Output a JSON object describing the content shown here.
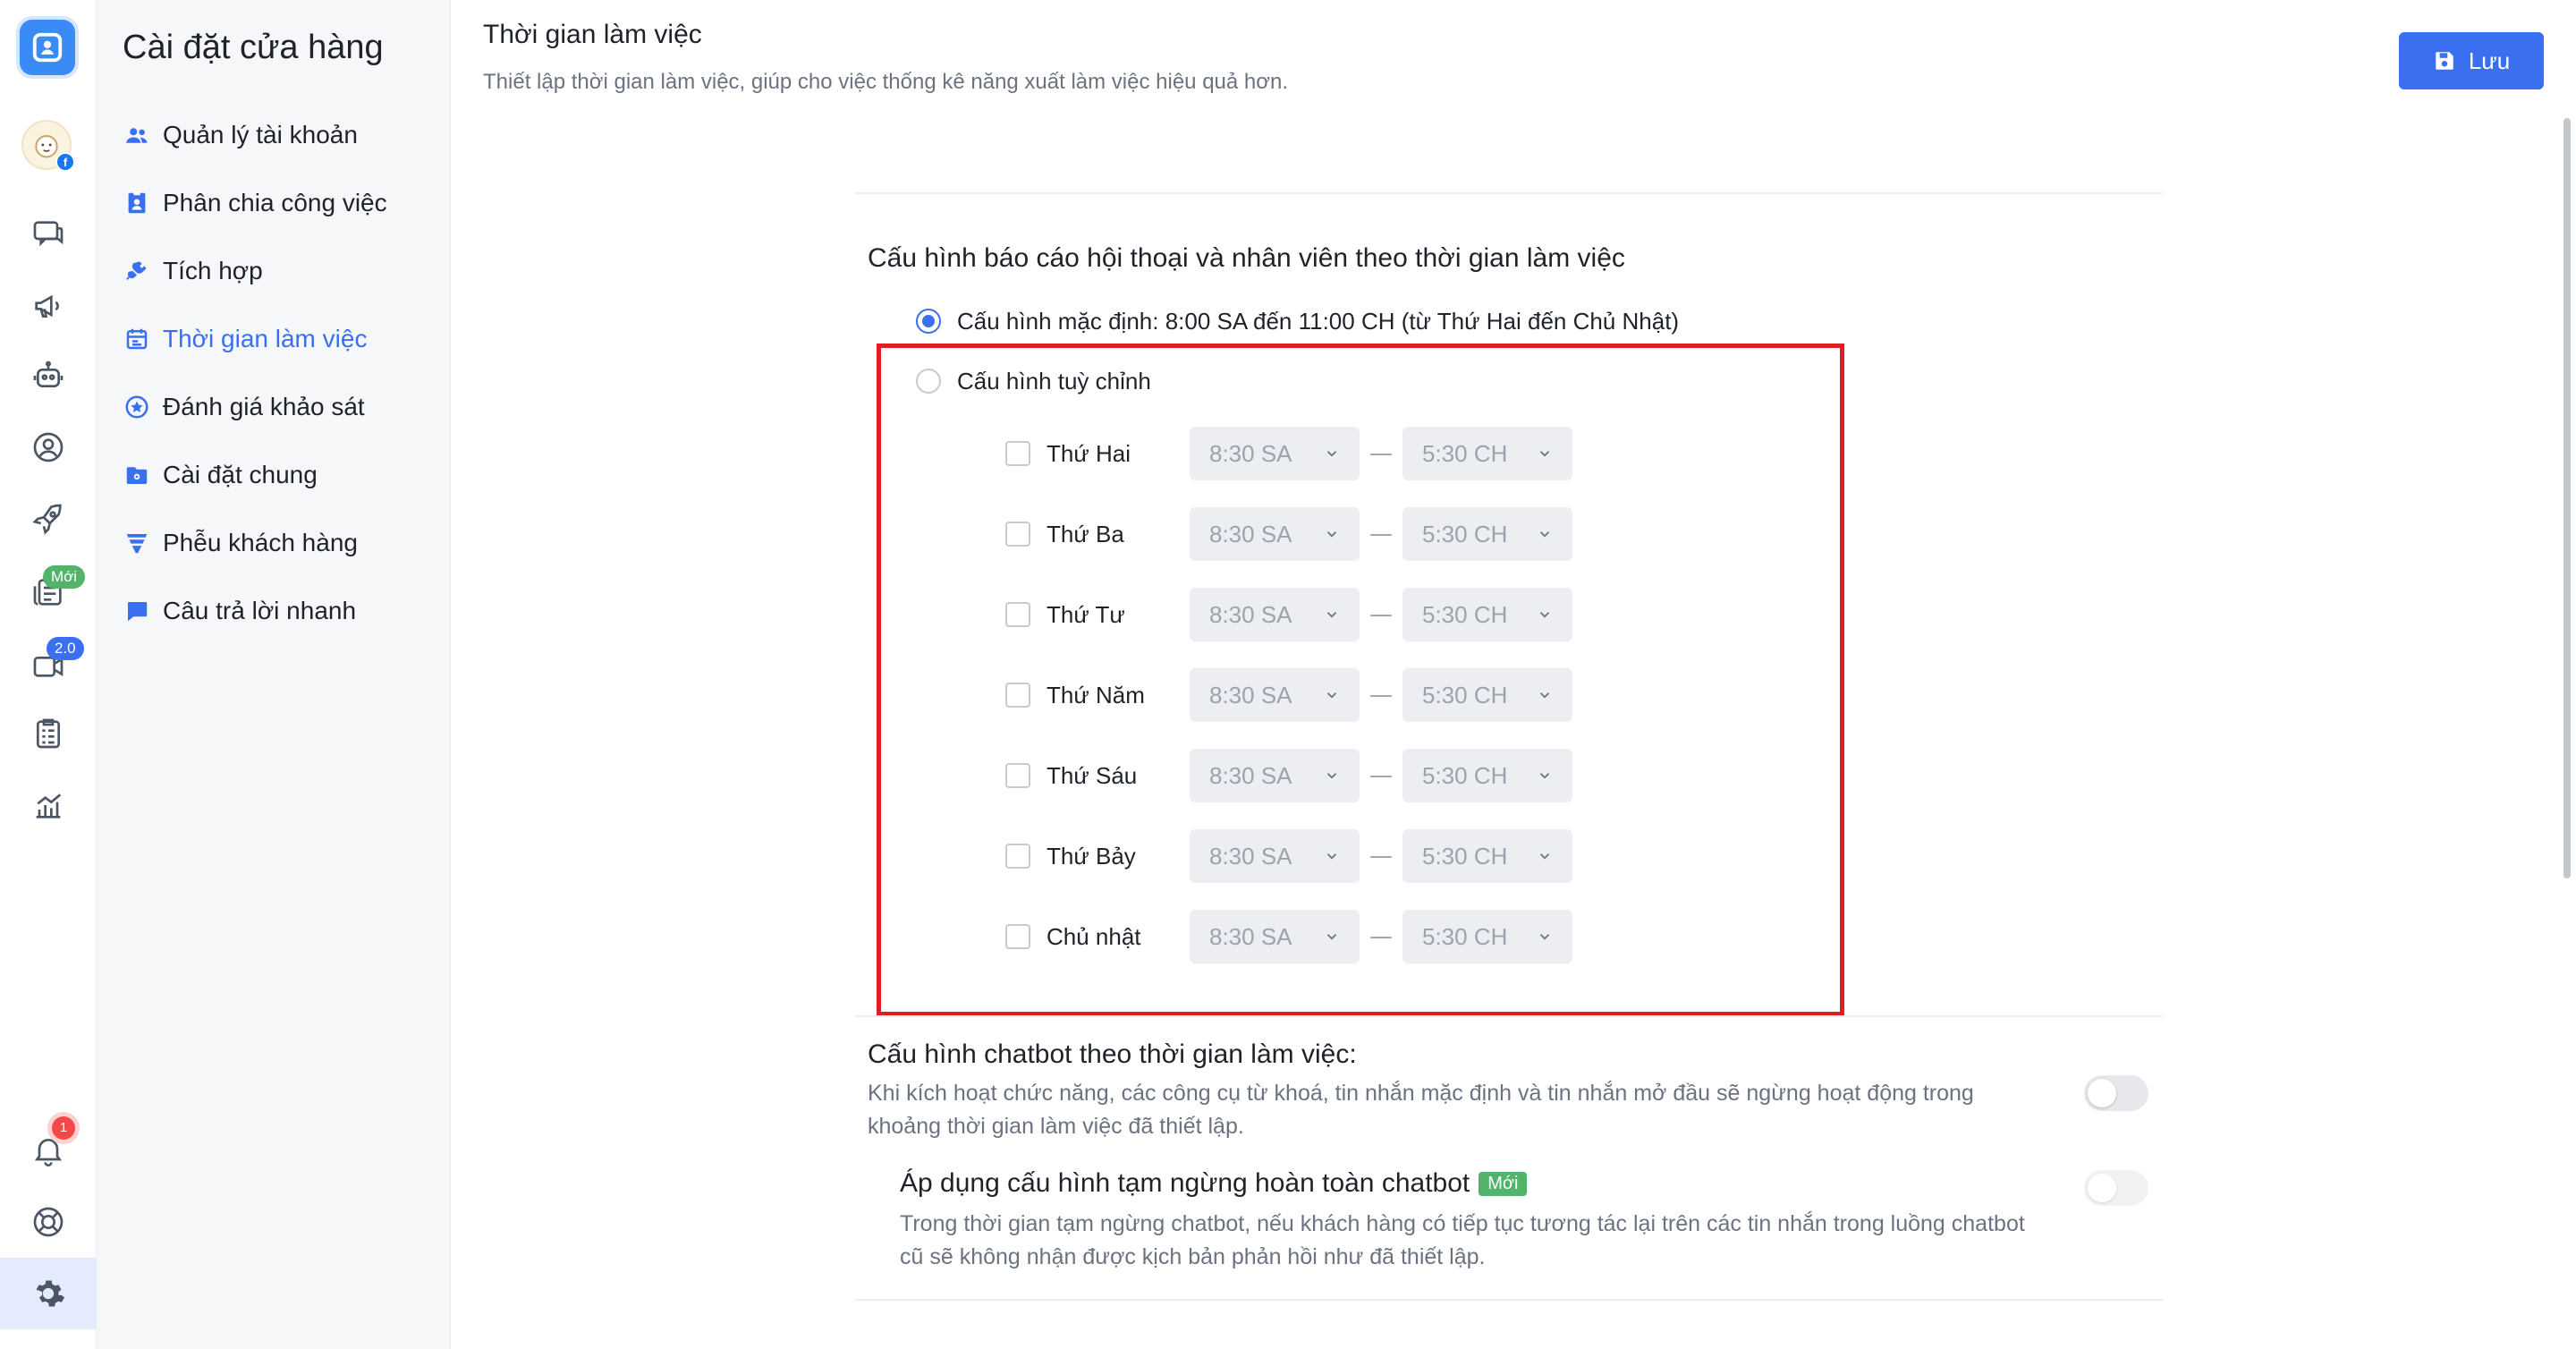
{
  "rail": {
    "badges": {
      "new": "Mới",
      "version": "2.0",
      "notifications": "1"
    },
    "facebook_mark": "f"
  },
  "sidebar": {
    "title": "Cài đặt cửa hàng",
    "items": [
      {
        "label": "Quản lý tài khoản",
        "icon": "users-icon"
      },
      {
        "label": "Phân chia công việc",
        "icon": "id-badge-icon"
      },
      {
        "label": "Tích hợp",
        "icon": "plug-icon"
      },
      {
        "label": "Thời gian làm việc",
        "icon": "calendar-icon",
        "active": true
      },
      {
        "label": "Đánh giá khảo sát",
        "icon": "star-badge-icon"
      },
      {
        "label": "Cài đặt chung",
        "icon": "folder-gear-icon"
      },
      {
        "label": "Phễu khách hàng",
        "icon": "funnel-icon"
      },
      {
        "label": "Câu trả lời nhanh",
        "icon": "chat-bubble-icon"
      }
    ]
  },
  "header": {
    "title": "Thời gian làm việc",
    "description": "Thiết lập thời gian làm việc, giúp cho việc thống kê năng xuất làm việc hiệu quả hơn.",
    "save_label": "Lưu"
  },
  "report_config": {
    "title": "Cấu hình báo cáo hội thoại và nhân viên theo thời gian làm việc",
    "default_option": "Cấu hình mặc định: 8:00 SA đến 11:00 CH (từ Thứ Hai đến Chủ Nhật)",
    "custom_option": "Cấu hình tuỳ chỉnh",
    "selected": "default",
    "days": [
      {
        "label": "Thứ Hai",
        "start": "8:30 SA",
        "end": "5:30 CH"
      },
      {
        "label": "Thứ Ba",
        "start": "8:30 SA",
        "end": "5:30 CH"
      },
      {
        "label": "Thứ Tư",
        "start": "8:30 SA",
        "end": "5:30 CH"
      },
      {
        "label": "Thứ Năm",
        "start": "8:30 SA",
        "end": "5:30 CH"
      },
      {
        "label": "Thứ Sáu",
        "start": "8:30 SA",
        "end": "5:30 CH"
      },
      {
        "label": "Thứ Bảy",
        "start": "8:30 SA",
        "end": "5:30 CH"
      },
      {
        "label": "Chủ nhật",
        "start": "8:30 SA",
        "end": "5:30 CH"
      }
    ],
    "separator": "—"
  },
  "chatbot_config": {
    "title": "Cấu hình chatbot theo thời gian làm việc:",
    "description": "Khi kích hoạt chức năng, các công cụ từ khoá, tin nhắn mặc định và tin nhắn mở đầu sẽ ngừng hoạt động trong khoảng thời gian làm việc đã thiết lập.",
    "enabled": false
  },
  "pause_config": {
    "title": "Áp dụng cấu hình tạm ngừng hoàn toàn chatbot",
    "tag": "Mới",
    "description": "Trong thời gian tạm ngừng chatbot, nếu khách hàng có tiếp tục tương tác lại trên các tin nhắn trong luồng chatbot cũ sẽ không nhận được kịch bản phản hồi như đã thiết lập.",
    "enabled": false
  },
  "colors": {
    "accent": "#3a6ff0",
    "highlight_box": "#e11d23",
    "new_tag": "#52b36a"
  }
}
